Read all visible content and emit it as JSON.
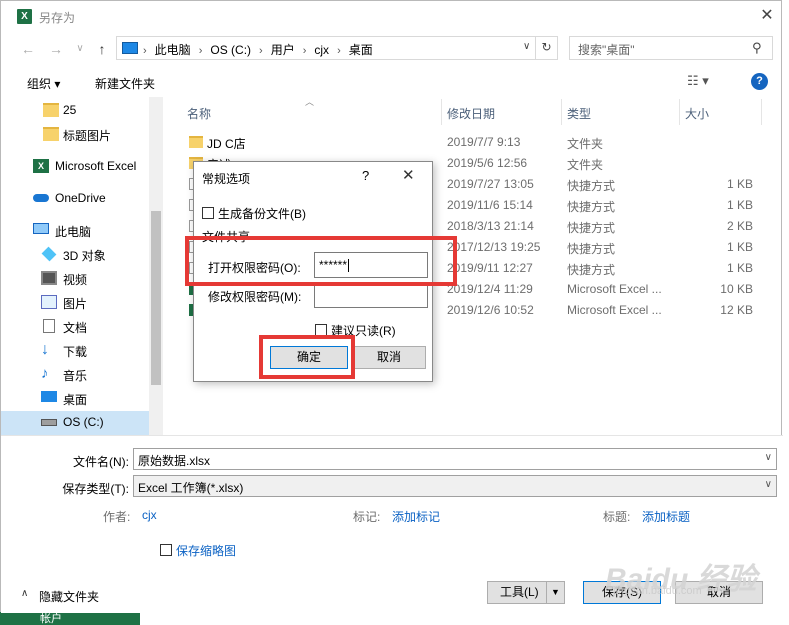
{
  "window": {
    "title": "另存为",
    "app_icon": "X",
    "close_glyph": "✕"
  },
  "nav": {
    "back": "←",
    "forward": "→",
    "recent": "∨",
    "up": "↑",
    "breadcrumbs": [
      "此电脑",
      "OS (C:)",
      "用户",
      "cjx",
      "桌面"
    ],
    "search_placeholder": "搜索\"桌面\"",
    "refresh": "↻"
  },
  "toolbar": {
    "organize": "组织 ▾",
    "new_folder": "新建文件夹",
    "view": "☷ ▾",
    "help": "?"
  },
  "sidebar": {
    "items": [
      {
        "label": "25",
        "icon": "folder-icon"
      },
      {
        "label": "标题图片",
        "icon": "folder-icon"
      },
      {
        "label": "Microsoft Excel",
        "icon": "excel-icon"
      },
      {
        "label": "OneDrive",
        "icon": "cloud-icon"
      },
      {
        "label": "此电脑",
        "icon": "computer-icon"
      },
      {
        "label": "3D 对象",
        "icon": "cube-icon"
      },
      {
        "label": "视频",
        "icon": "video-icon"
      },
      {
        "label": "图片",
        "icon": "picture-icon"
      },
      {
        "label": "文档",
        "icon": "document-icon"
      },
      {
        "label": "下载",
        "icon": "download-icon"
      },
      {
        "label": "音乐",
        "icon": "music-icon"
      },
      {
        "label": "桌面",
        "icon": "desktop-icon"
      },
      {
        "label": "OS (C:)",
        "icon": "drive-icon"
      }
    ]
  },
  "filelist": {
    "columns": [
      "名称",
      "修改日期",
      "类型",
      "大小"
    ],
    "rows": [
      {
        "name": "JD C店",
        "date": "2019/7/7 9:13",
        "type": "文件夹",
        "size": ""
      },
      {
        "name": "音述",
        "date": "2019/5/6 12:56",
        "type": "文件夹",
        "size": ""
      },
      {
        "name": "",
        "date": "2019/7/27 13:05",
        "type": "快捷方式",
        "size": "1 KB"
      },
      {
        "name": "",
        "date": "2019/11/6 15:14",
        "type": "快捷方式",
        "size": "1 KB"
      },
      {
        "name": "",
        "date": "2018/3/13 21:14",
        "type": "快捷方式",
        "size": "2 KB"
      },
      {
        "name": "",
        "date": "2017/12/13 19:25",
        "type": "快捷方式",
        "size": "1 KB"
      },
      {
        "name": "",
        "date": "2019/9/11 12:27",
        "type": "快捷方式",
        "size": "1 KB"
      },
      {
        "name": "",
        "date": "2019/12/4 11:29",
        "type": "Microsoft Excel ...",
        "size": "10 KB"
      },
      {
        "name": "",
        "date": "2019/12/6 10:52",
        "type": "Microsoft Excel ...",
        "size": "12 KB"
      }
    ]
  },
  "form": {
    "filename_label": "文件名(N):",
    "filename_value": "原始数据.xlsx",
    "filetype_label": "保存类型(T):",
    "filetype_value": "Excel 工作簿(*.xlsx)",
    "author_label": "作者:",
    "author_value": "cjx",
    "tags_label": "标记:",
    "tags_value": "添加标记",
    "title_label": "标题:",
    "title_value": "添加标题",
    "thumbnail_label": "保存缩略图",
    "hide_folders": "隐藏文件夹",
    "tools": "工具(L)",
    "save": "保存(S)",
    "cancel": "取消"
  },
  "modal": {
    "title": "常规选项",
    "help": "?",
    "close": "✕",
    "backup_label": "生成备份文件(B)",
    "sharing_label": "文件共享",
    "open_pwd_label": "打开权限密码(O):",
    "open_pwd_value": "******",
    "modify_pwd_label": "修改权限密码(M):",
    "modify_pwd_value": "",
    "readonly_label": "建议只读(R)",
    "ok": "确定",
    "cancel": "取消"
  },
  "watermark": {
    "main": "Baidu 经验",
    "sub": "jingyan.baidu.com"
  },
  "under_window": "帐户",
  "colors": {
    "excel_green": "#1e7145",
    "highlight_red": "#e53935",
    "link_blue": "#0b62c4",
    "selection": "#cce4f7"
  }
}
